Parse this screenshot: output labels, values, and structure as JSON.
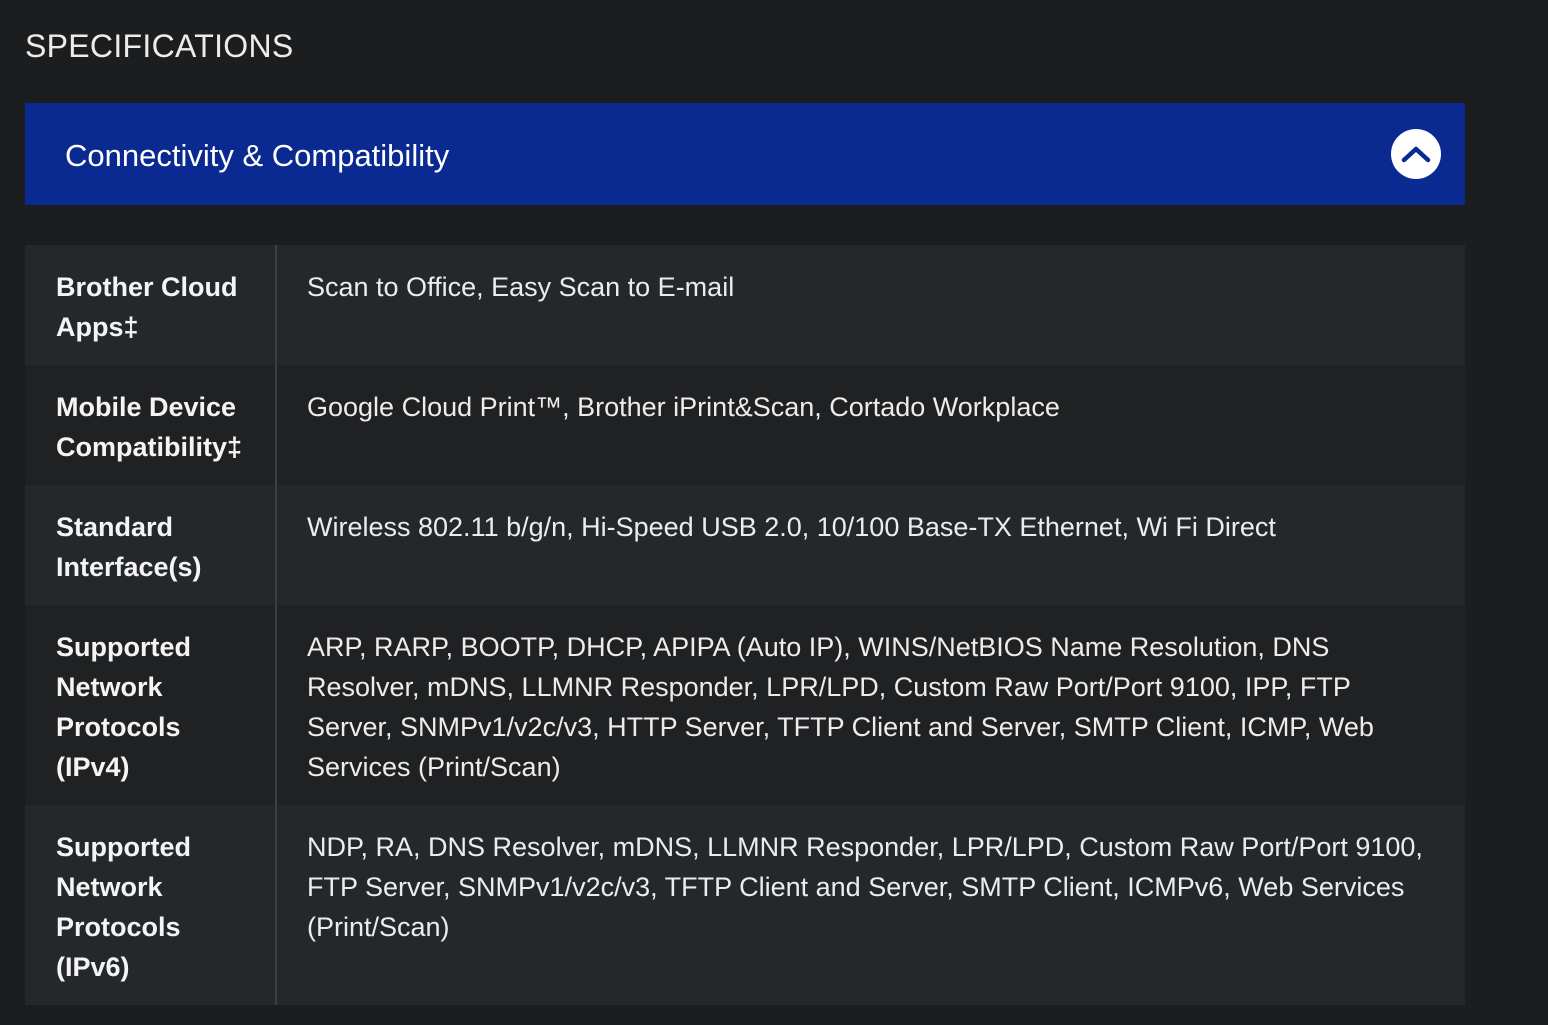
{
  "page": {
    "heading": "SPECIFICATIONS"
  },
  "accordion": {
    "title": "Connectivity & Compatibility",
    "toggle_icon": "chevron-up-icon",
    "expanded": true,
    "colors": {
      "header_bg": "#0a2a92",
      "page_bg": "#1b1d1f"
    }
  },
  "specs": {
    "rows": [
      {
        "label": "Brother Cloud Apps‡",
        "value": "Scan to Office, Easy Scan to E-mail"
      },
      {
        "label": "Mobile Device Compatibility‡",
        "value": "Google Cloud Print™, Brother iPrint&Scan, Cortado Workplace"
      },
      {
        "label": "Standard Interface(s)",
        "value": "Wireless 802.11 b/g/n, Hi-Speed USB 2.0, 10/100 Base-TX Ethernet, Wi Fi Direct"
      },
      {
        "label": "Supported Network Protocols (IPv4)",
        "value": "ARP, RARP, BOOTP, DHCP, APIPA (Auto IP), WINS/NetBIOS Name Resolution, DNS Resolver, mDNS, LLMNR Responder, LPR/LPD, Custom Raw Port/Port 9100, IPP, FTP Server, SNMPv1/v2c/v3, HTTP Server, TFTP Client and Server, SMTP Client, ICMP, Web Services (Print/Scan)"
      },
      {
        "label": "Supported Network Protocols (IPv6)",
        "value": "NDP, RA, DNS Resolver, mDNS, LLMNR Responder, LPR/LPD, Custom Raw Port/Port 9100, FTP Server, SNMPv1/v2c/v3, TFTP Client and Server, SMTP Client, ICMPv6, Web Services (Print/Scan)"
      }
    ]
  }
}
